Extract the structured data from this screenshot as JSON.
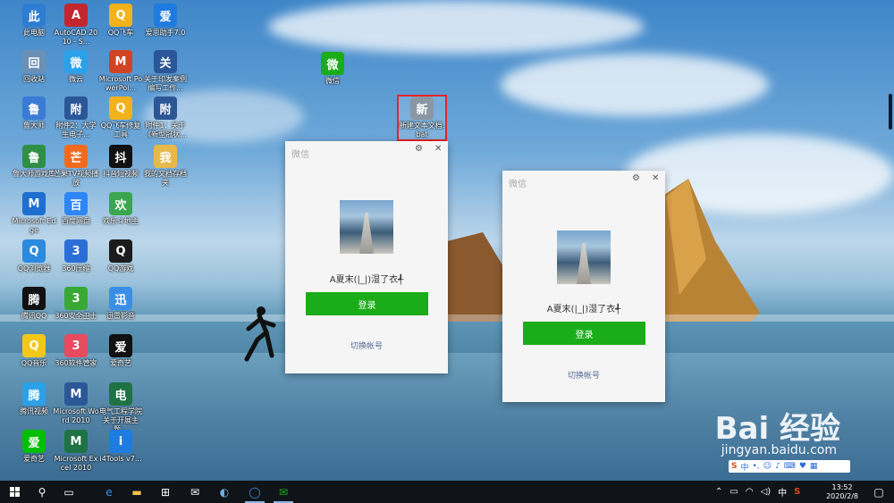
{
  "desktop_icons": [
    {
      "label": "此电脑",
      "icon": "computer-icon",
      "color": "#2d7dd2"
    },
    {
      "label": "AutoCAD 2010 - S...",
      "icon": "autocad-icon",
      "color": "#c4262e"
    },
    {
      "label": "QQ飞车",
      "icon": "qq-speed-icon",
      "color": "#f2b21b"
    },
    {
      "label": "爱思助手7.0",
      "icon": "i4-icon",
      "color": "#1e7be0"
    },
    {
      "label": "回收站",
      "icon": "recycle-bin-icon",
      "color": "#6b8fb5"
    },
    {
      "label": "微云",
      "icon": "weiyun-icon",
      "color": "#2aa1e8"
    },
    {
      "label": "Microsoft PowerPoi...",
      "icon": "powerpoint-icon",
      "color": "#d04423"
    },
    {
      "label": "关于印发案例编写工作...",
      "icon": "word-doc-icon",
      "color": "#2b5797"
    },
    {
      "label": "鲁大师",
      "icon": "ludashi-icon",
      "color": "#3a7bd5"
    },
    {
      "label": "附件2：大学生电子...",
      "icon": "word-doc-icon",
      "color": "#2b5797"
    },
    {
      "label": "QQ飞车修复工具",
      "icon": "qq-speed-icon",
      "color": "#f2b21b"
    },
    {
      "label": "附件1：关于《新型冠状...",
      "icon": "word-doc-icon",
      "color": "#2b5797"
    },
    {
      "label": "鲁大师游戏库",
      "icon": "game-lib-icon",
      "color": "#2f8f46"
    },
    {
      "label": "芒果TV视频播放",
      "icon": "mgtv-icon",
      "color": "#f26b1d"
    },
    {
      "label": "抖音短视频",
      "icon": "douyin-icon",
      "color": "#111111"
    },
    {
      "label": "我的文档存档夹",
      "icon": "folder-icon",
      "color": "#e8b84a"
    },
    {
      "label": "Microsoft Edge",
      "icon": "edge-icon",
      "color": "#1e6fd0"
    },
    {
      "label": "百度网盘",
      "icon": "baidu-netdisk-icon",
      "color": "#2f86f6"
    },
    {
      "label": "欢乐斗地主",
      "icon": "game-icon",
      "color": "#3aa64f"
    },
    {
      "label": "QQ浏览器",
      "icon": "qq-browser-icon",
      "color": "#2a8ae0"
    },
    {
      "label": "360压缩",
      "icon": "360zip-icon",
      "color": "#2b6fd6"
    },
    {
      "label": "QQ游戏",
      "icon": "qq-game-icon",
      "color": "#1c1c1c"
    },
    {
      "label": "腾讯QQ",
      "icon": "qq-icon",
      "color": "#111111"
    },
    {
      "label": "360安全卫士",
      "icon": "360safe-icon",
      "color": "#39a935"
    },
    {
      "label": "迅雷影音",
      "icon": "xunlei-icon",
      "color": "#3a8ee6"
    },
    {
      "label": "QQ音乐",
      "icon": "qq-music-icon",
      "color": "#f4c81b"
    },
    {
      "label": "360软件管家",
      "icon": "360soft-icon",
      "color": "#e84a5f"
    },
    {
      "label": "爱奇艺",
      "icon": "iqiyi-icon",
      "color": "#111111"
    },
    {
      "label": "腾讯视频",
      "icon": "tencent-video-icon",
      "color": "#2aa1e8"
    },
    {
      "label": "Microsoft Word 2010",
      "icon": "word-icon",
      "color": "#2b5797"
    },
    {
      "label": "电气工程学院关于开展主题...",
      "icon": "excel-doc-icon",
      "color": "#1f7244"
    },
    {
      "label": "爱奇艺",
      "icon": "iqiyi-icon",
      "color": "#00be06"
    },
    {
      "label": "Microsoft Excel 2010",
      "icon": "excel-icon",
      "color": "#1f7244"
    },
    {
      "label": "i4Tools v7...",
      "icon": "i4-icon",
      "color": "#1e7be0"
    },
    {
      "label": "微信",
      "icon": "wechat-icon",
      "color": "#1aad19"
    },
    {
      "label": "新建文本文档.bat",
      "icon": "bat-file-icon",
      "color": "#8a96a3"
    }
  ],
  "windows": [
    {
      "title": "微信",
      "username": "A夏末(|_|)湿了衣╃",
      "login_label": "登录",
      "switch_label": "切换帐号"
    },
    {
      "title": "微信",
      "username": "A夏末(|_|)湿了衣╃",
      "login_label": "登录",
      "switch_label": "切换帐号"
    }
  ],
  "watermark": {
    "brand": "Bai 经验",
    "url": "jingyan.baidu.com"
  },
  "ime": {
    "mode": "中"
  },
  "taskbar": {
    "items": [
      "windows-start-icon",
      "search-icon",
      "task-view-icon",
      "edge-icon",
      "file-explorer-icon",
      "store-icon",
      "mail-icon",
      "browser-icon",
      "qq-browser-icon",
      "wechat-icon"
    ],
    "time": "13:52",
    "date": "2020/2/8"
  }
}
